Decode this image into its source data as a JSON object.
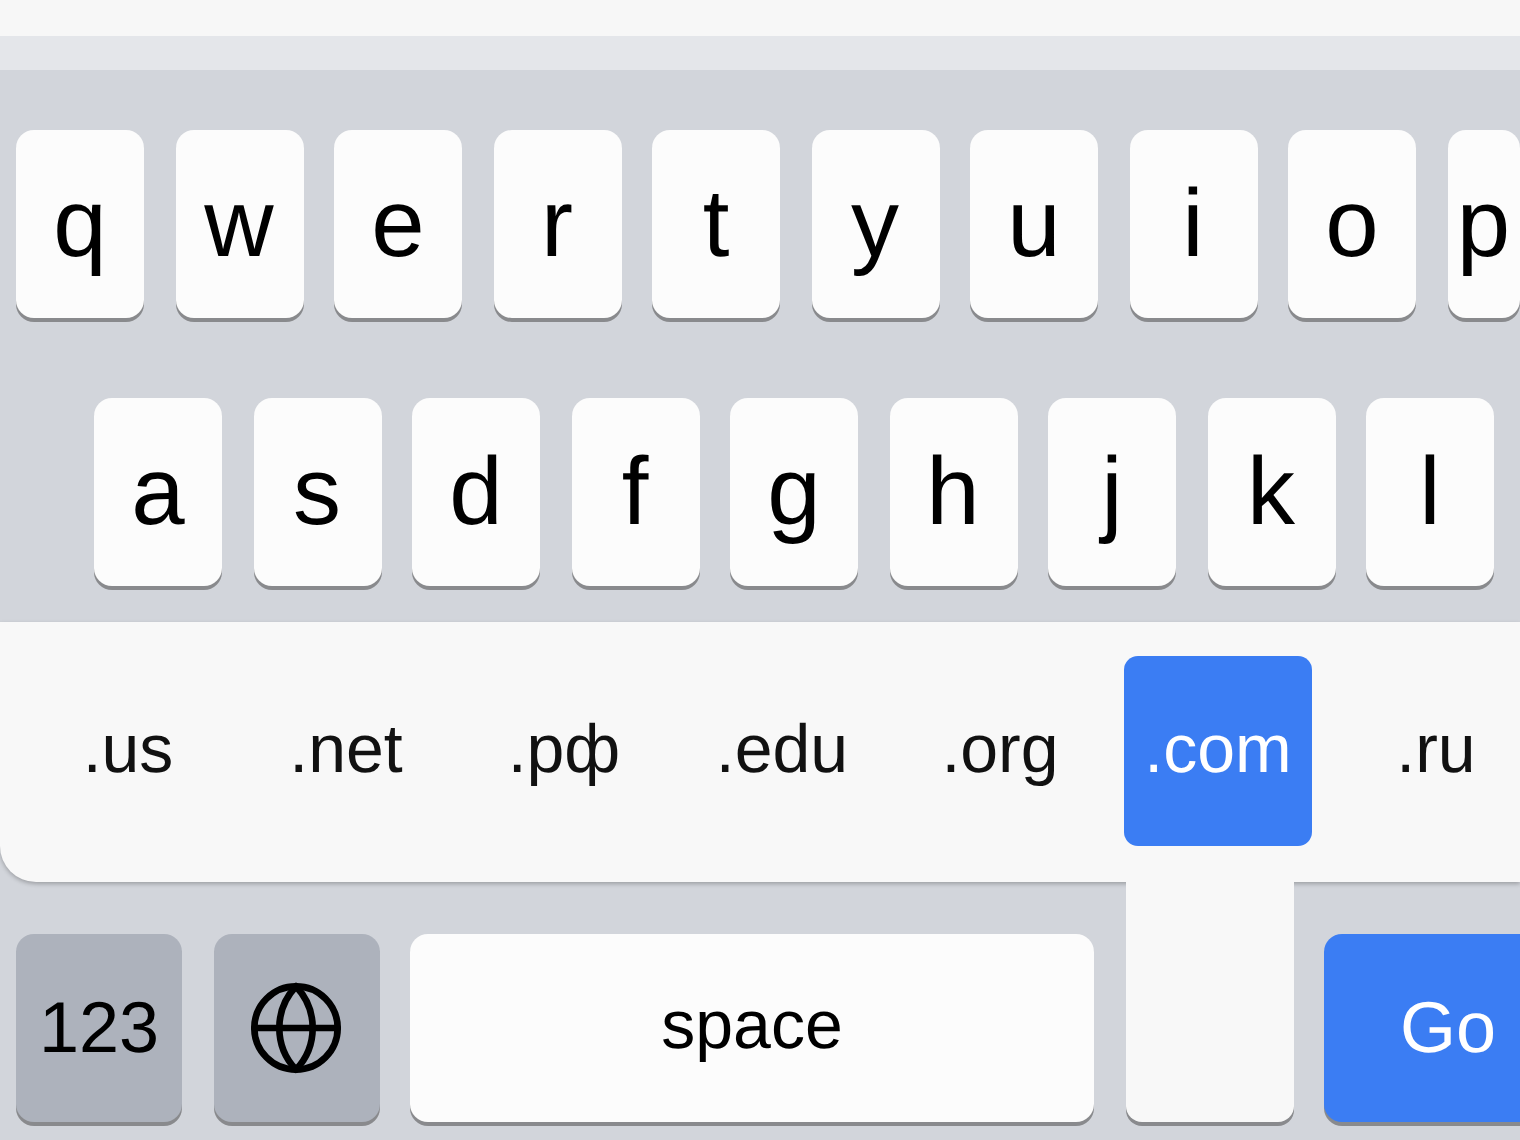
{
  "keyboard": {
    "rows": [
      {
        "keys": [
          "q",
          "w",
          "e",
          "r",
          "t",
          "y",
          "u",
          "i",
          "o",
          "p"
        ]
      },
      {
        "keys": [
          "a",
          "s",
          "d",
          "f",
          "g",
          "h",
          "j",
          "k",
          "l"
        ]
      }
    ],
    "domain_popup": {
      "items": [
        {
          "label": ".us",
          "selected": false
        },
        {
          "label": ".net",
          "selected": false
        },
        {
          "label": ".pф",
          "selected": false
        },
        {
          "label": ".edu",
          "selected": false
        },
        {
          "label": ".org",
          "selected": false
        },
        {
          "label": ".com",
          "selected": true
        },
        {
          "label": ".ru",
          "selected": false
        }
      ]
    },
    "bottom_row": [
      {
        "kind": "mode",
        "label": "123"
      },
      {
        "kind": "globe"
      },
      {
        "kind": "space",
        "label": "space"
      },
      {
        "kind": "stem"
      },
      {
        "kind": "go",
        "label": "Go"
      }
    ]
  }
}
